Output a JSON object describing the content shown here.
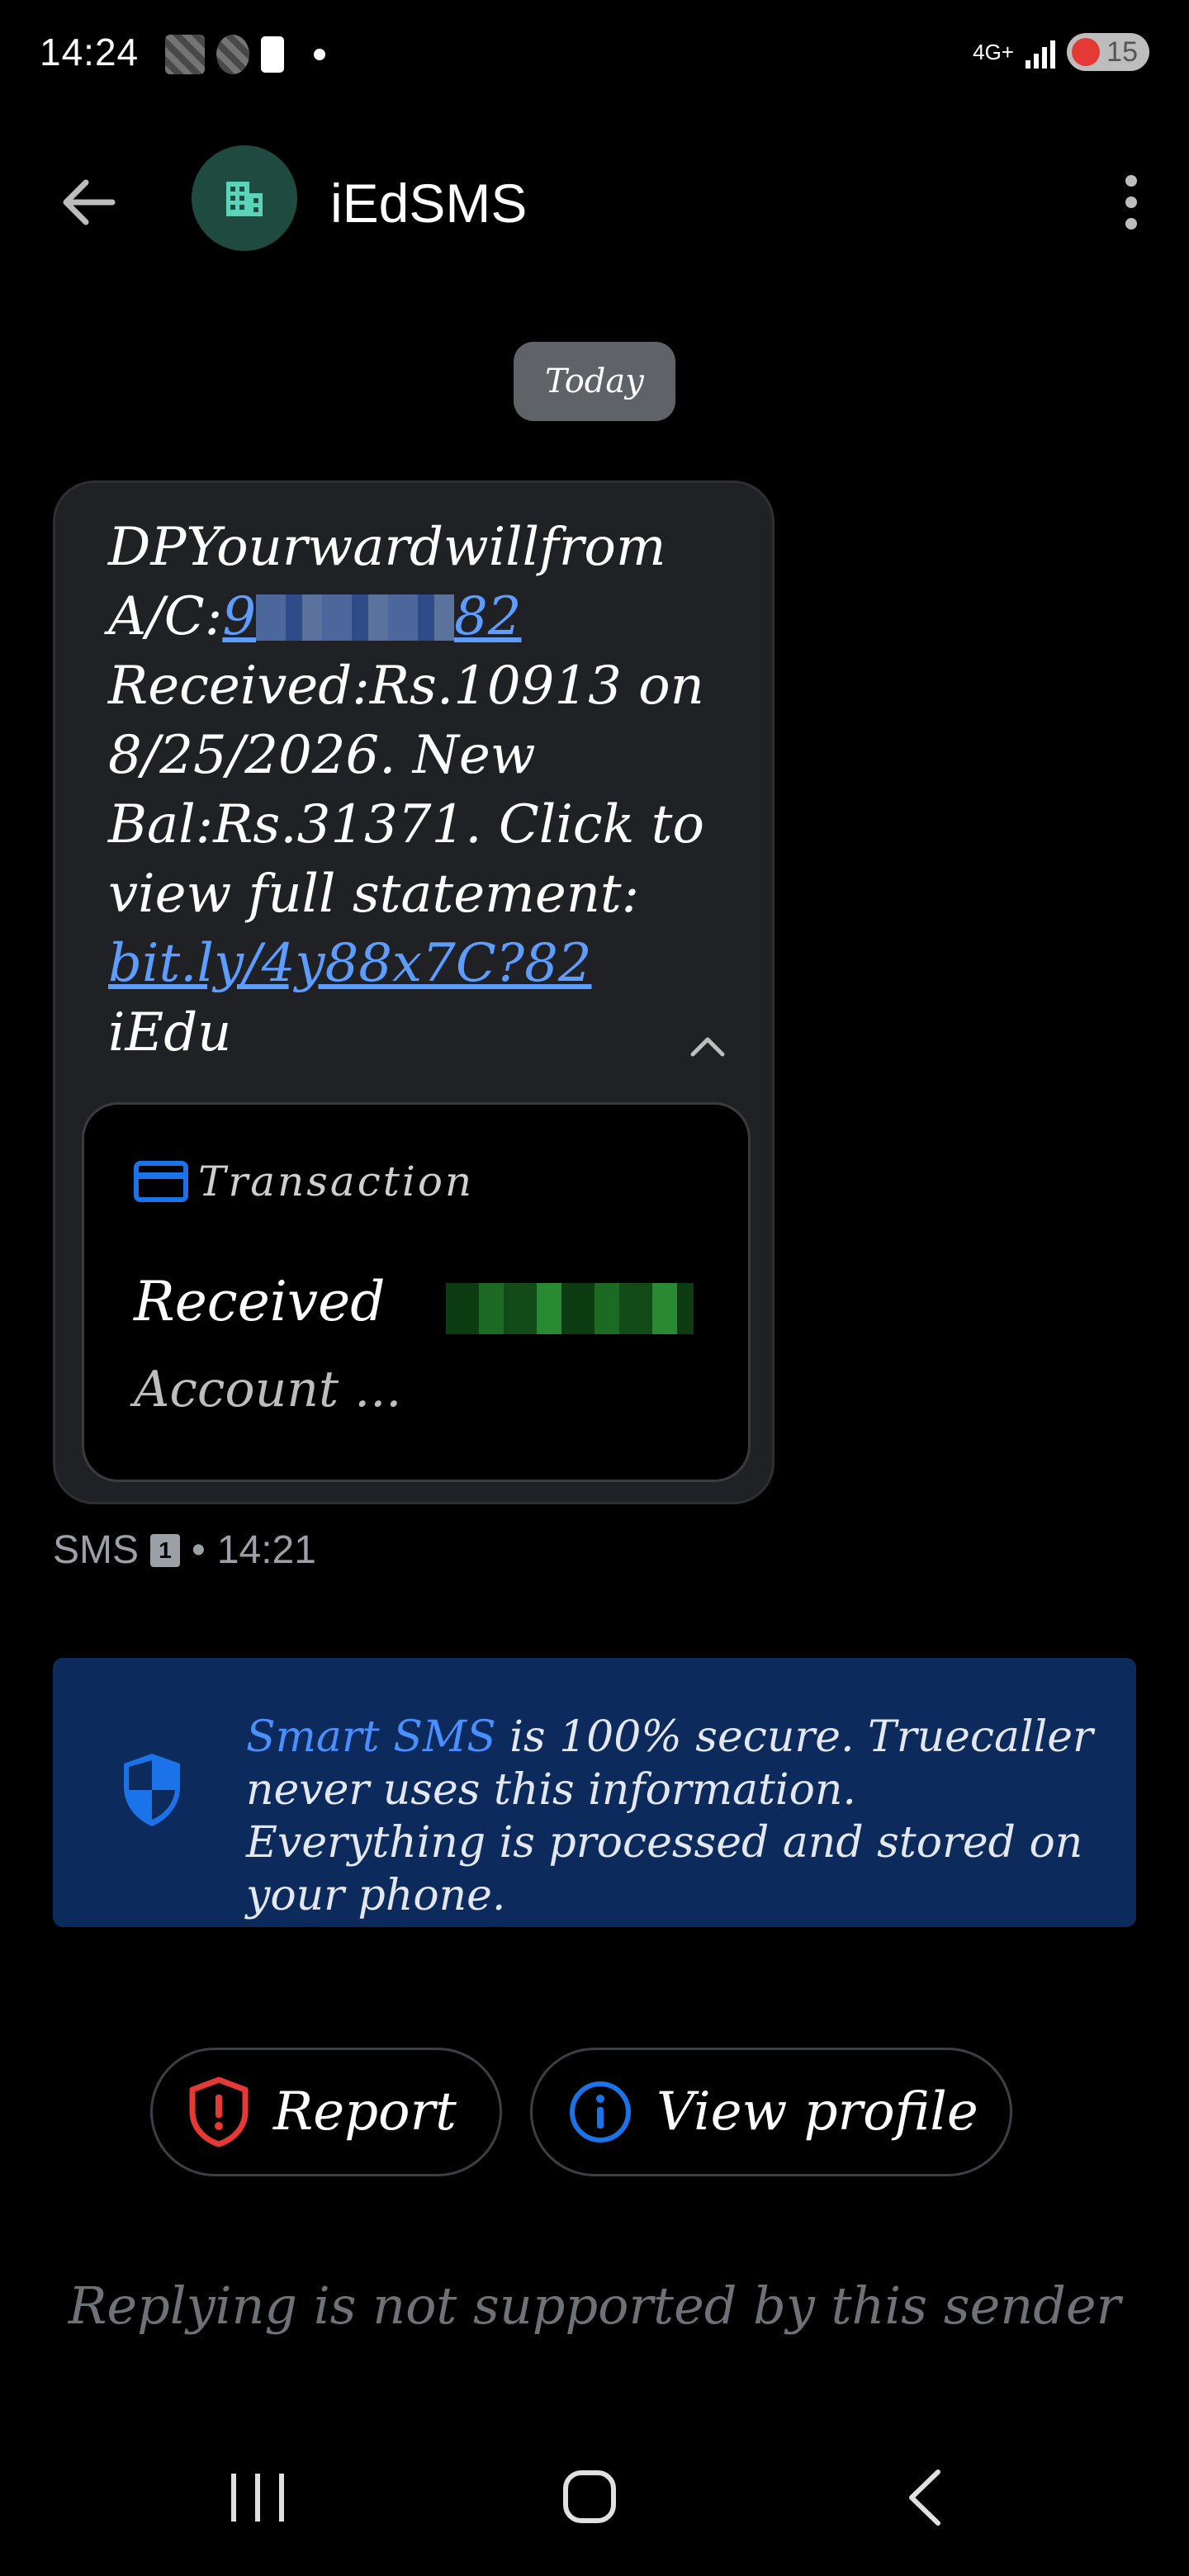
{
  "status_bar": {
    "time": "14:24",
    "network": "4G+",
    "battery": "15"
  },
  "header": {
    "sender": "iEdSMS"
  },
  "date_chip": "Today",
  "message": {
    "line1": "DPYourwardwillfrom",
    "account_prefix": "A/C:",
    "account_visible_start": "9",
    "account_visible_end": "82",
    "body": "Received:Rs.10913 on 8/25/2026. New Bal:Rs.31371. Click to view full statement:",
    "link": "bit.ly/4y88x7C?82",
    "signature": "iEdu"
  },
  "transaction_card": {
    "heading": "Transaction",
    "label": "Received",
    "subtitle": "Account ..."
  },
  "meta": {
    "channel": "SMS",
    "sim": "1",
    "separator": "•",
    "time": "14:21"
  },
  "banner": {
    "highlight": "Smart SMS",
    "text": " is 100% secure. Truecaller never uses this information. Everything is processed and stored on your phone."
  },
  "actions": {
    "report": "Report",
    "view_profile": "View profile"
  },
  "reply_note": "Replying is not supported by this sender",
  "colors": {
    "background": "#000000",
    "bubble": "#202124",
    "link": "#5c9dff",
    "banner": "#0d2a5c",
    "accent_blue": "#1a73e8",
    "report_red": "#e53935",
    "avatar": "#1f4a40"
  }
}
